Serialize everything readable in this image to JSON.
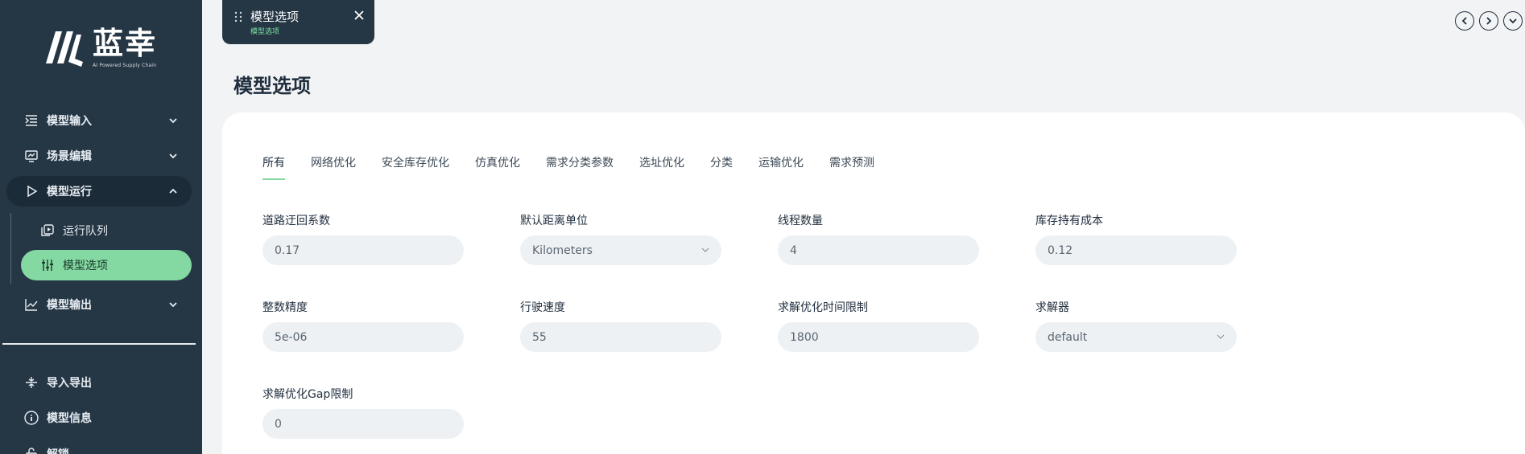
{
  "brand": {
    "name": "蓝幸",
    "tagline": "AI Powered Supply Chain"
  },
  "sidebar": {
    "items": [
      {
        "label": "模型输入",
        "icon": "list-indent-icon"
      },
      {
        "label": "场景编辑",
        "icon": "monitor-chart-icon"
      },
      {
        "label": "模型运行",
        "icon": "play-icon"
      },
      {
        "label": "模型输出",
        "icon": "line-chart-icon"
      }
    ],
    "subitems": [
      {
        "label": "运行队列",
        "icon": "queue-icon"
      },
      {
        "label": "模型选项",
        "icon": "sliders-icon"
      }
    ],
    "bottom": [
      {
        "label": "导入导出",
        "icon": "import-export-icon"
      },
      {
        "label": "模型信息",
        "icon": "info-icon"
      },
      {
        "label": "解锁",
        "icon": "unlock-icon"
      }
    ]
  },
  "open_tab": {
    "title": "模型选项",
    "subtitle": "模型选项"
  },
  "page": {
    "title": "模型选项"
  },
  "tabs": [
    "所有",
    "网络优化",
    "安全库存优化",
    "仿真优化",
    "需求分类参数",
    "选址优化",
    "分类",
    "运输优化",
    "需求预测"
  ],
  "fields": [
    {
      "label": "道路迂回系数",
      "value": "0.17"
    },
    {
      "label": "默认距离单位",
      "value": "Kilometers"
    },
    {
      "label": "线程数量",
      "value": "4"
    },
    {
      "label": "库存持有成本",
      "value": "0.12"
    },
    {
      "label": "整数精度",
      "value": "5e-06"
    },
    {
      "label": "行驶速度",
      "value": "55"
    },
    {
      "label": "求解优化时间限制",
      "value": "1800"
    },
    {
      "label": "求解器",
      "value": "default"
    },
    {
      "label": "求解优化Gap限制",
      "value": "0"
    }
  ],
  "colors": {
    "sidebar_bg": "#253645",
    "accent_green": "#84d8a1",
    "page_bg": "#f2f3f5"
  }
}
